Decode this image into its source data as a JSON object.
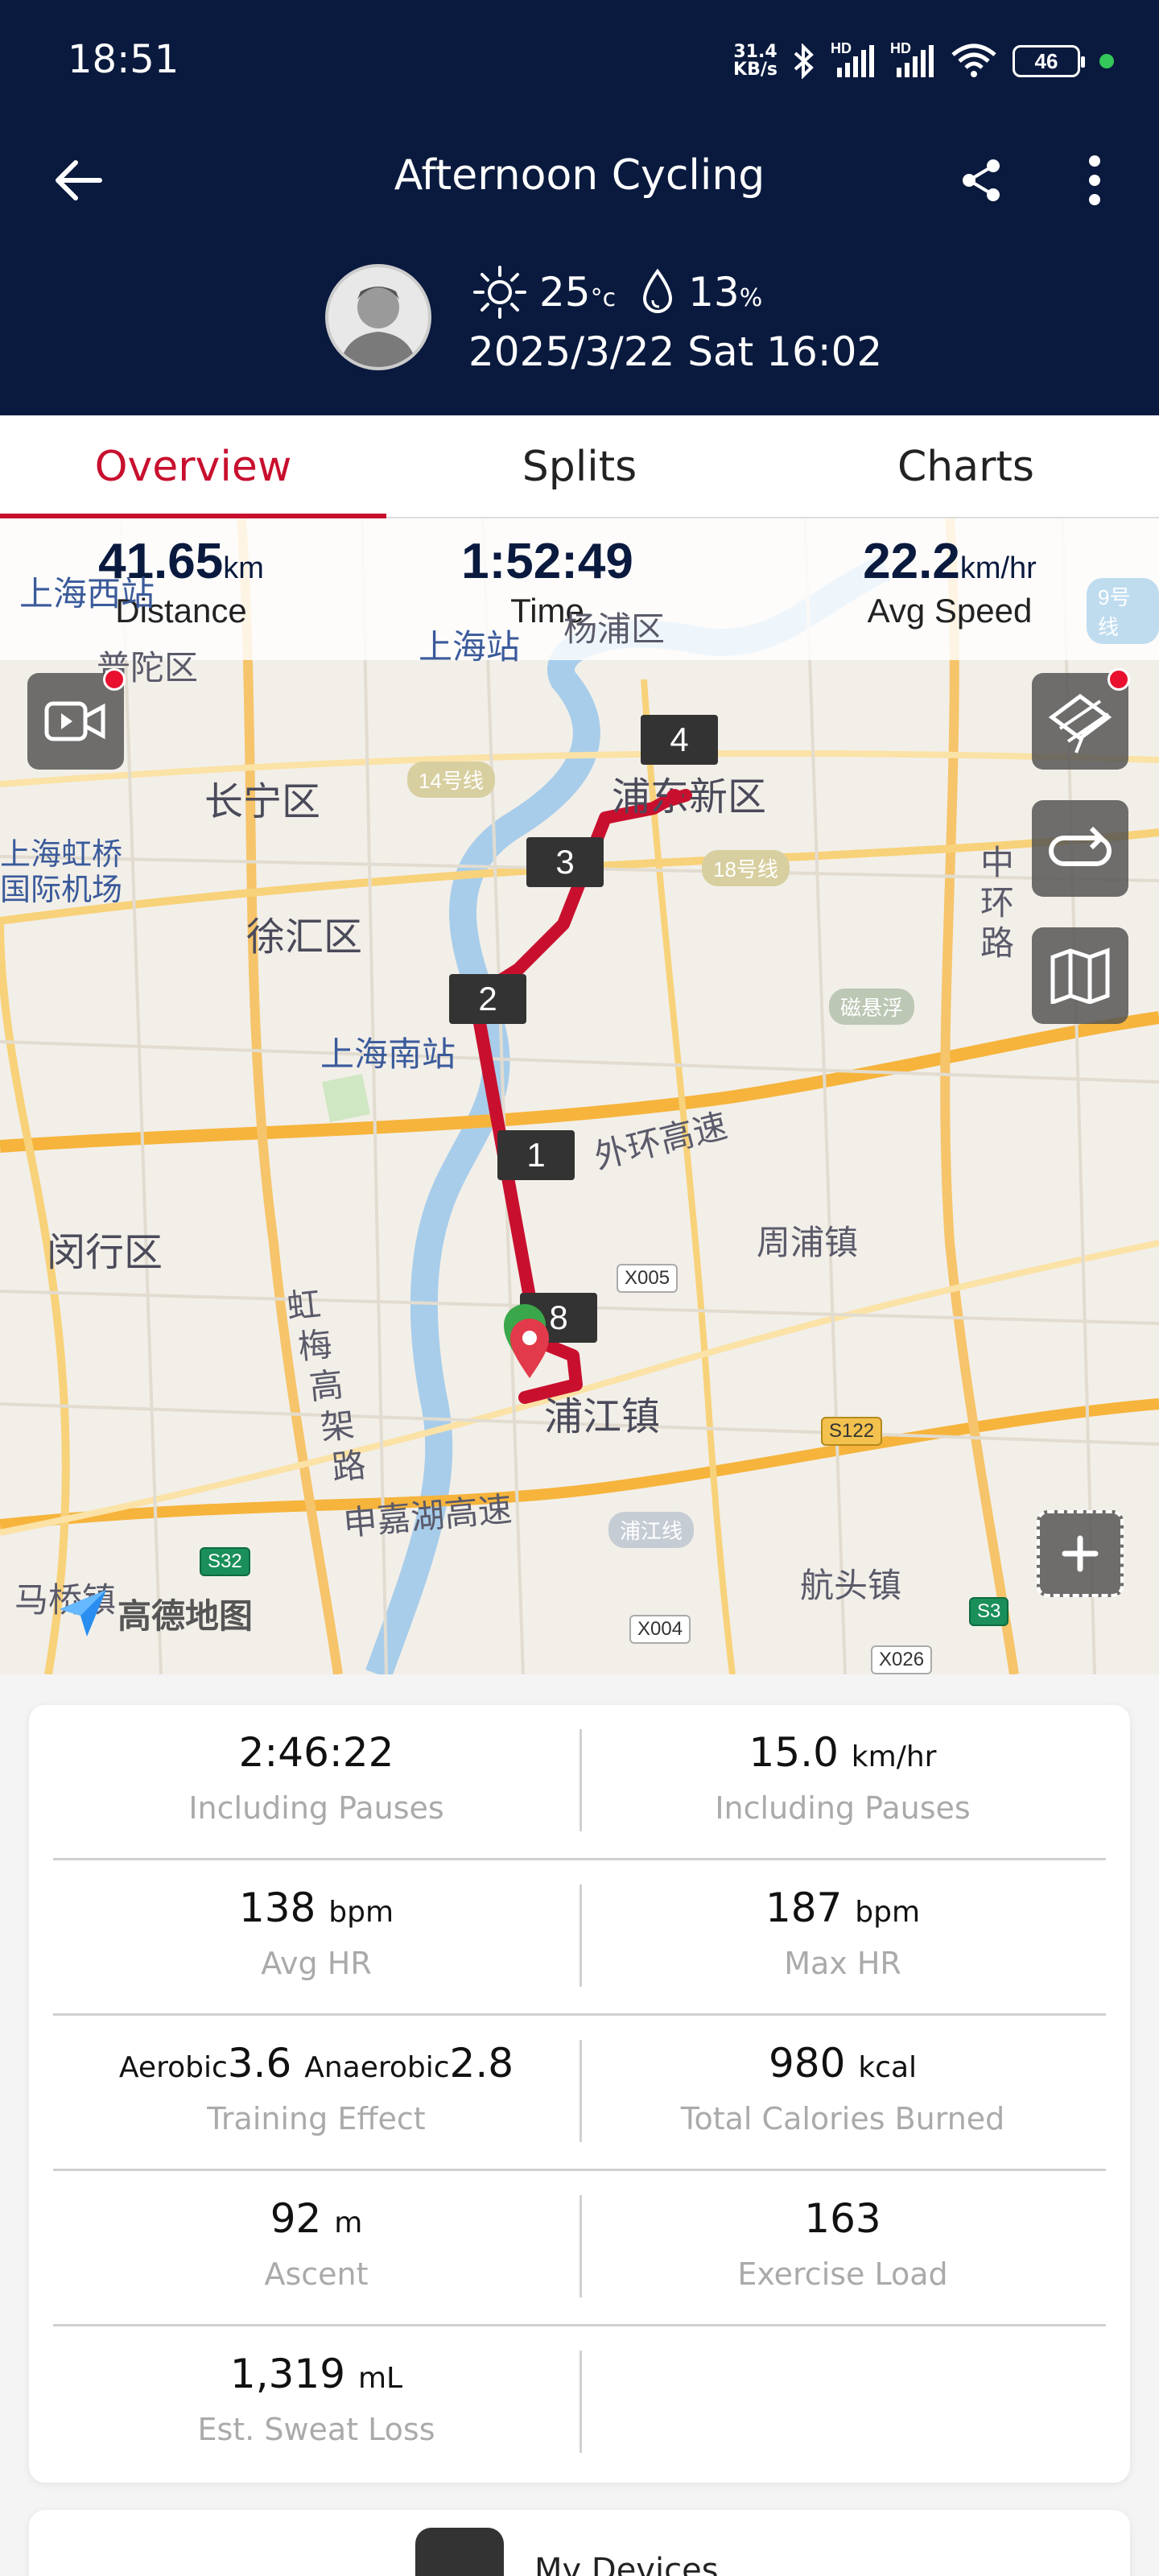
{
  "status_bar": {
    "time": "18:51",
    "net_speed_value": "31.4",
    "net_speed_unit": "KB/s",
    "signal1_label": "HD",
    "signal2_label": "HD",
    "battery": "46"
  },
  "header": {
    "title": "Afternoon Cycling",
    "temperature": "25",
    "temperature_unit": "°c",
    "humidity": "13",
    "humidity_unit": "%",
    "date": "2025/3/22 Sat 16:02"
  },
  "tabs": [
    {
      "label": "Overview",
      "active": true
    },
    {
      "label": "Splits",
      "active": false
    },
    {
      "label": "Charts",
      "active": false
    }
  ],
  "summary": {
    "distance_value": "41.65",
    "distance_unit": "km",
    "distance_label": "Distance",
    "time_value": "1:52:49",
    "time_label": "Time",
    "speed_value": "22.2",
    "speed_unit": "km/hr",
    "speed_label": "Avg Speed"
  },
  "map": {
    "labels": {
      "putuo": "普陀区",
      "shanghai_west": "上海西站",
      "shanghai_station": "上海站",
      "yangpu": "杨浦区",
      "changning": "长宁区",
      "pudong": "浦东新区",
      "hongqiao1": "上海虹桥",
      "hongqiao2": "国际机场",
      "xuhui": "徐汇区",
      "south_station": "上海南站",
      "middle_ring": [
        "中",
        "环",
        "路"
      ],
      "outer_ring": "外环高速",
      "zhoupu": "周浦镇",
      "minhang": "闵行区",
      "hongmei": [
        "虹",
        "梅",
        "高",
        "架",
        "路"
      ],
      "pujiang": "浦江镇",
      "shenjia": "申嘉湖高速",
      "hangtou": "航头镇",
      "maqiao": "马桥镇",
      "amap": "高德地图"
    },
    "badges": {
      "line14": "14号线",
      "line18": "18号线",
      "maglev": "磁悬浮",
      "pujiang_line": "浦江线",
      "x005": "X005",
      "s122": "S122",
      "s32": "S32",
      "x004": "X004",
      "s3": "S3",
      "x026": "X026",
      "line9": "9号线"
    },
    "split_markers": [
      "1",
      "2",
      "3",
      "4",
      "8"
    ],
    "route_color": "#c8102e"
  },
  "stats": [
    {
      "left": {
        "value": "2:46:22",
        "unit": "",
        "label": "Including Pauses"
      },
      "right": {
        "value": "15.0",
        "unit": "km/hr",
        "label": "Including Pauses"
      }
    },
    {
      "left": {
        "value": "138",
        "unit": "bpm",
        "label": "Avg HR"
      },
      "right": {
        "value": "187",
        "unit": "bpm",
        "label": "Max HR"
      }
    },
    {
      "left": {
        "aerobic_label": "Aerobic",
        "aerobic_value": "3.6",
        "anaerobic_label": "Anaerobic",
        "anaerobic_value": "2.8",
        "label": "Training Effect"
      },
      "right": {
        "value": "980",
        "unit": "kcal",
        "label": "Total Calories Burned"
      }
    },
    {
      "left": {
        "value": "92",
        "unit": "m",
        "label": "Ascent"
      },
      "right": {
        "value": "163",
        "unit": "",
        "label": "Exercise Load"
      }
    },
    {
      "left": {
        "value": "1,319",
        "unit": "mL",
        "label": "Est. Sweat Loss"
      },
      "right": {
        "value": "",
        "unit": "",
        "label": ""
      }
    }
  ],
  "devices": {
    "label": "My Devices"
  },
  "colors": {
    "header_bg": "#0a1a3e",
    "accent": "#c8102e"
  }
}
